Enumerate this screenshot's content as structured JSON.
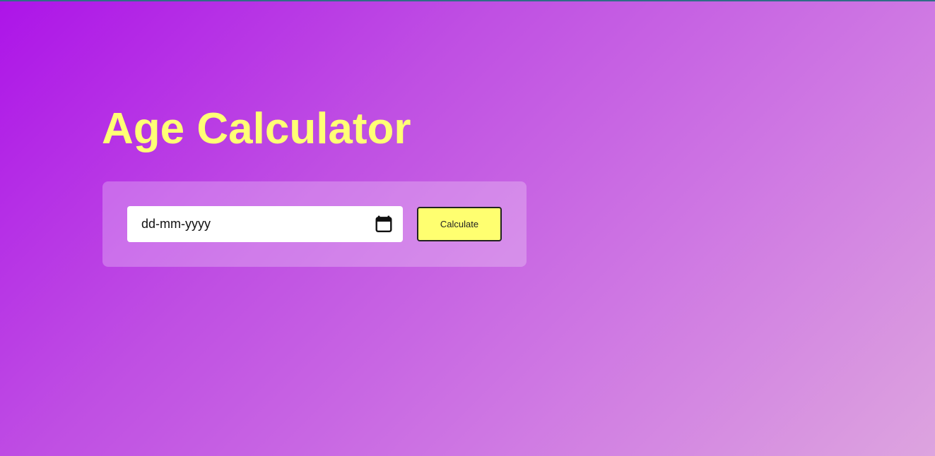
{
  "page": {
    "title": "Age Calculator",
    "colors": {
      "gradient_start": "#ad14e8",
      "gradient_end": "#dda4df",
      "title": "#ffff75",
      "button": "#ffff70",
      "top_line": "#2f6d86"
    }
  },
  "form": {
    "date_input": {
      "placeholder": "dd-mm-yyyy",
      "value": "",
      "icon": "calendar-icon"
    },
    "calculate_label": "Calculate"
  }
}
